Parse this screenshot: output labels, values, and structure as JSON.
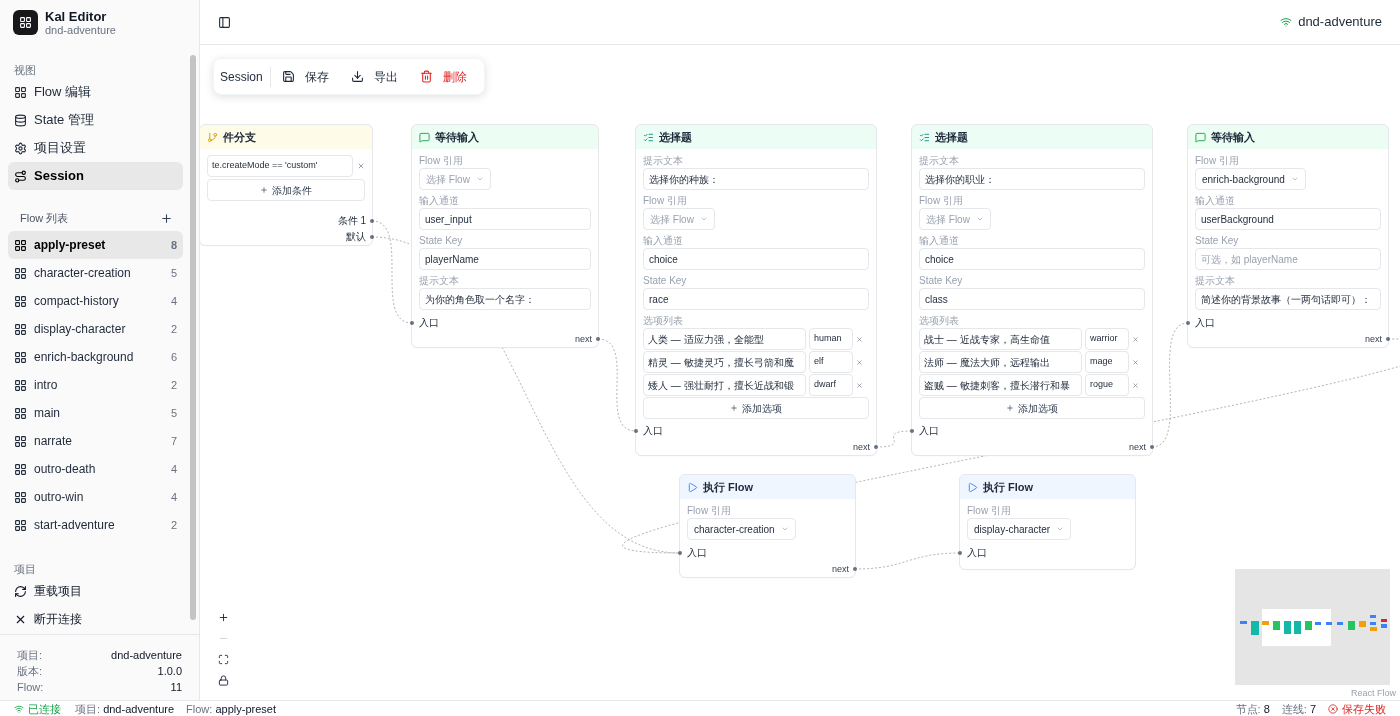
{
  "app": {
    "title": "Kal Editor",
    "subtitle": "dnd-adventure"
  },
  "sidebar": {
    "view_label": "视图",
    "view_items": [
      {
        "label": "Flow 编辑",
        "selected": false
      },
      {
        "label": "State 管理",
        "selected": false
      },
      {
        "label": "项目设置",
        "selected": false
      },
      {
        "label": "Session",
        "selected": true
      }
    ],
    "flow_list_title": "Flow 列表",
    "flows": [
      {
        "name": "apply-preset",
        "count": "8",
        "selected": true
      },
      {
        "name": "character-creation",
        "count": "5",
        "selected": false
      },
      {
        "name": "compact-history",
        "count": "4",
        "selected": false
      },
      {
        "name": "display-character",
        "count": "2",
        "selected": false
      },
      {
        "name": "enrich-background",
        "count": "6",
        "selected": false
      },
      {
        "name": "intro",
        "count": "2",
        "selected": false
      },
      {
        "name": "main",
        "count": "5",
        "selected": false
      },
      {
        "name": "narrate",
        "count": "7",
        "selected": false
      },
      {
        "name": "outro-death",
        "count": "4",
        "selected": false
      },
      {
        "name": "outro-win",
        "count": "4",
        "selected": false
      },
      {
        "name": "start-adventure",
        "count": "2",
        "selected": false
      }
    ],
    "project_label": "项目",
    "project_actions": [
      "重载项目",
      "断开连接"
    ],
    "info": [
      {
        "label": "项目:",
        "value": "dnd-adventure"
      },
      {
        "label": "版本:",
        "value": "1.0.0"
      },
      {
        "label": "Flow:",
        "value": "11"
      }
    ]
  },
  "topbar": {
    "connection": "dnd-adventure",
    "connected": true
  },
  "toolbar": {
    "title": "Session",
    "buttons": [
      {
        "label": "保存",
        "kind": "normal"
      },
      {
        "label": "导出",
        "kind": "normal"
      },
      {
        "label": "删除",
        "kind": "danger"
      }
    ]
  },
  "nodes": [
    {
      "kind": "condition",
      "title": "件分支",
      "conditions": [
        "te.createMode == 'custom'"
      ],
      "add_label": "添加条件",
      "outputs": [
        "条件 1",
        "默认"
      ]
    },
    {
      "kind": "wait_input",
      "title": "等待输入",
      "fields": [
        {
          "label": "Flow 引用",
          "kind": "select",
          "placeholder": "选择 Flow"
        },
        {
          "label": "输入通道",
          "kind": "text",
          "value": "user_input"
        },
        {
          "label": "State Key",
          "kind": "text",
          "value": "playerName"
        },
        {
          "label": "提示文本",
          "kind": "text",
          "value": "为你的角色取一个名字："
        }
      ],
      "input": "入口",
      "outputs": [
        "next"
      ]
    },
    {
      "kind": "choice",
      "title": "选择题",
      "fields": [
        {
          "label": "提示文本",
          "kind": "text",
          "value": "选择你的种族："
        },
        {
          "label": "Flow 引用",
          "kind": "select",
          "placeholder": "选择 Flow"
        },
        {
          "label": "输入通道",
          "kind": "text",
          "value": "choice"
        },
        {
          "label": "State Key",
          "kind": "text",
          "value": "race"
        }
      ],
      "options_label": "选项列表",
      "options": [
        {
          "label": "人类 — 适应力强，全能型",
          "value": "human"
        },
        {
          "label": "精灵 — 敏捷灵巧，擅长弓箭和魔",
          "value": "elf"
        },
        {
          "label": "矮人 — 强壮耐打，擅长近战和锻",
          "value": "dwarf"
        }
      ],
      "add_label": "添加选项",
      "input": "入口",
      "outputs": [
        "next"
      ]
    },
    {
      "kind": "choice",
      "title": "选择题",
      "fields": [
        {
          "label": "提示文本",
          "kind": "text",
          "value": "选择你的职业："
        },
        {
          "label": "Flow 引用",
          "kind": "select",
          "placeholder": "选择 Flow"
        },
        {
          "label": "输入通道",
          "kind": "text",
          "value": "choice"
        },
        {
          "label": "State Key",
          "kind": "text",
          "value": "class"
        }
      ],
      "options_label": "选项列表",
      "options": [
        {
          "label": "战士 — 近战专家，高生命值",
          "value": "warrior"
        },
        {
          "label": "法师 — 魔法大师，远程输出",
          "value": "mage"
        },
        {
          "label": "盗贼 — 敏捷刺客，擅长潜行和暴",
          "value": "rogue"
        }
      ],
      "add_label": "添加选项",
      "input": "入口",
      "outputs": [
        "next"
      ]
    },
    {
      "kind": "wait_input",
      "title": "等待输入",
      "fields": [
        {
          "label": "Flow 引用",
          "kind": "select",
          "value": "enrich-background"
        },
        {
          "label": "输入通道",
          "kind": "text",
          "value": "userBackground"
        },
        {
          "label": "State Key",
          "kind": "text",
          "placeholder": "可选，如 playerName"
        },
        {
          "label": "提示文本",
          "kind": "text",
          "value": "简述你的背景故事（一两句话即可）："
        }
      ],
      "input": "入口",
      "outputs": [
        "next"
      ]
    },
    {
      "kind": "run_flow",
      "title": "执行 Flow",
      "fields": [
        {
          "label": "Flow 引用",
          "kind": "select",
          "value": "character-creation"
        }
      ],
      "input": "入口",
      "outputs": [
        "next"
      ]
    },
    {
      "kind": "run_flow",
      "title": "执行 Flow",
      "fields": [
        {
          "label": "Flow 引用",
          "kind": "select",
          "value": "display-character"
        }
      ],
      "input": "入口"
    }
  ],
  "controls": [
    {
      "kind": "zoom_in",
      "disabled": false
    },
    {
      "kind": "zoom_out",
      "disabled": true
    },
    {
      "kind": "fit",
      "disabled": false
    },
    {
      "kind": "lock",
      "disabled": false
    }
  ],
  "attribution": "React Flow",
  "status_bar": {
    "connection": {
      "label": "已连接",
      "connected": true
    },
    "items": [
      {
        "label": "项目:",
        "value": "dnd-adventure"
      },
      {
        "label": "Flow:",
        "value": "apply-preset"
      }
    ],
    "counts": [
      {
        "label": "节点:",
        "value": "8"
      },
      {
        "label": "连线:",
        "value": "7"
      }
    ],
    "save": {
      "label": "保存失败",
      "failed": true
    }
  }
}
